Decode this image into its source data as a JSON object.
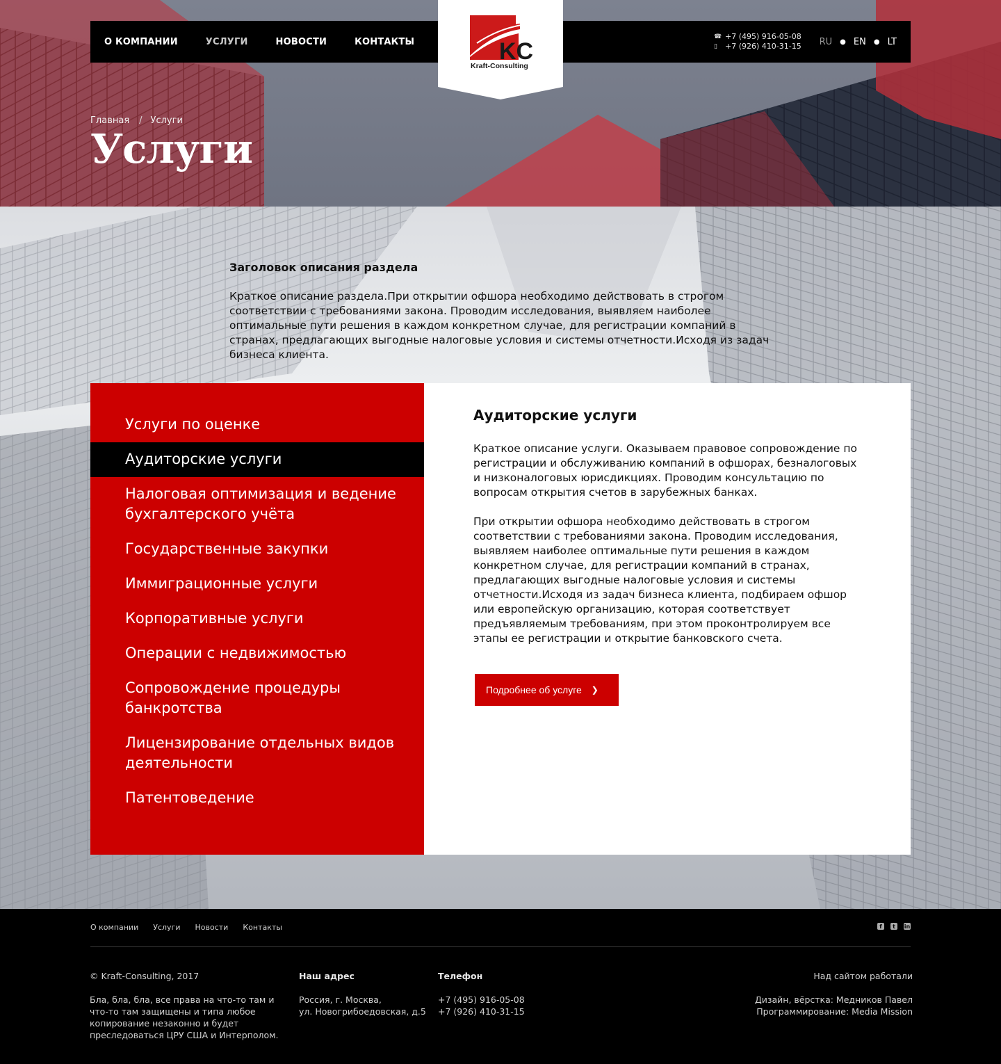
{
  "nav": {
    "links": [
      "О КОМПАНИИ",
      "УСЛУГИ",
      "НОВОСТИ",
      "КОНТАКТЫ"
    ],
    "phones": [
      "+7 (495) 916-05-08",
      "+7 (926) 410-31-15"
    ],
    "phone_icons": [
      "phone-icon",
      "mobile-icon"
    ],
    "langs": [
      "RU",
      "EN",
      "LT"
    ],
    "logo": {
      "initials": "KC",
      "name": "Kraft-Consulting"
    }
  },
  "hero": {
    "breadcrumb": [
      "Главная",
      "Услуги"
    ],
    "title": "Услуги"
  },
  "intro": {
    "heading": "Заголовок описания раздела",
    "text": "Краткое описание раздела.При открытии офшора необходимо действовать в строгом соответствии с требованиями закона. Проводим исследования, выявляем наиболее оптимальные пути решения в каждом конкретном случае, для регистрации компаний в странах, предлагающих выгодные налоговые условия и системы отчетности.Исходя из задач бизнеса клиента."
  },
  "services": {
    "items": [
      "Услуги по оценке",
      "Аудиторские услуги",
      "Налоговая оптимизация и ведение бухгалтерского учёта",
      "Государственные закупки",
      "Иммиграционные услуги",
      "Корпоративные услуги",
      "Операции с недвижимостью",
      "Сопровождение процедуры банкротства",
      "Лицензирование отдельных видов деятельности",
      "Патентоведение"
    ],
    "active_index": 1,
    "detail": {
      "title": "Аудиторские услуги",
      "p1": "Краткое описание услуги. Оказываем правовое сопровождение по регистрации и обслуживанию компаний в офшорах, безналоговых и низконалоговых юрисдикциях. Проводим консультацию по вопросам открытия счетов в зарубежных банках.",
      "p2": "При открытии офшора необходимо действовать в строгом соответствии с требованиями закона. Проводим исследования, выявляем наиболее оптимальные пути решения в каждом конкретном случае, для регистрации компаний в странах, предлагающих выгодные налоговые условия и системы отчетности.Исходя из задач бизнеса клиента, подбираем офшор или европейскую организацию, которая соответствует предъявляемым требованиям, при этом проконтролируем все этапы ее регистрации и открытие банковского счета.",
      "button": "Подробнее об услуге",
      "button_icon": "chevron-right-icon"
    }
  },
  "footer": {
    "links": [
      "О компании",
      "Услуги",
      "Новости",
      "Контакты"
    ],
    "social_icons": [
      "facebook-icon",
      "twitter-icon",
      "linkedin-icon"
    ],
    "copyright": "© Kraft-Consulting, 2017",
    "legal": "Бла, бла, бла, все права на что-то там и что-то там защищены и типа любое копирование незаконно и будет преследоваться ЦРУ США и Интерполом.",
    "address_head": "Наш адрес",
    "address_lines": [
      "Россия, г. Москва,",
      "ул. Новогрибоедовская, д.5"
    ],
    "phone_head": "Телефон",
    "phone_lines": [
      "+7 (495) 916-05-08",
      "+7 (926) 410-31-15"
    ],
    "credits_head": "Над сайтом работали",
    "credits_lines": [
      "Дизайн, вёрстка: Медников Павел",
      "Программирование: Media Mission"
    ]
  },
  "colors": {
    "accent": "#cc0000",
    "nav_bg": "#000000",
    "footer_bg": "#000000"
  }
}
